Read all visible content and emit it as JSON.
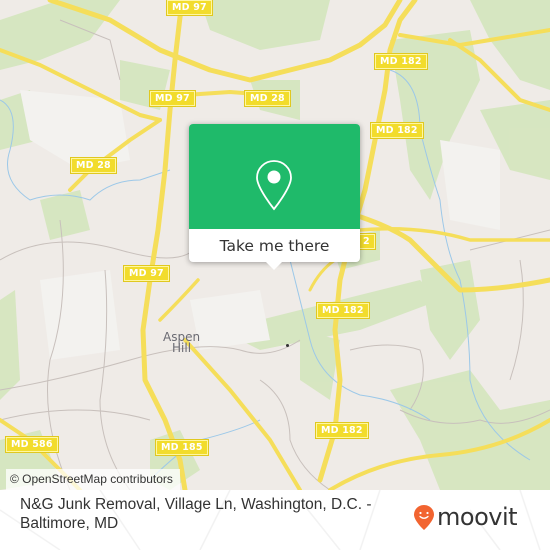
{
  "map": {
    "road_labels": [
      {
        "id": "md97-top",
        "text": "MD 97"
      },
      {
        "id": "md97-mid",
        "text": "MD 97"
      },
      {
        "id": "md28-mid",
        "text": "MD 28"
      },
      {
        "id": "md28-left",
        "text": "MD 28"
      },
      {
        "id": "md182-top",
        "text": "MD 182"
      },
      {
        "id": "md182-upper",
        "text": "MD 182"
      },
      {
        "id": "md182-partial",
        "text": "2"
      },
      {
        "id": "md97-lower",
        "text": "MD 97"
      },
      {
        "id": "md182-center",
        "text": "MD 182"
      },
      {
        "id": "md182-bottom",
        "text": "MD 182"
      },
      {
        "id": "md586",
        "text": "MD 586"
      },
      {
        "id": "md185",
        "text": "MD 185"
      }
    ],
    "place_label": {
      "line1": "Aspen",
      "line2": "Hill"
    },
    "attribution": "© OpenStreetMap contributors"
  },
  "popup": {
    "icon": "map-pin-icon",
    "button_label": "Take me there",
    "color": "#1fba6a"
  },
  "footer": {
    "title": "N&G Junk Removal, Village Ln, Washington, D.C. - Baltimore, MD",
    "logo_text": "moovit",
    "logo_icon": "moovit-smiley-pin-icon",
    "logo_color": "#f26430"
  }
}
